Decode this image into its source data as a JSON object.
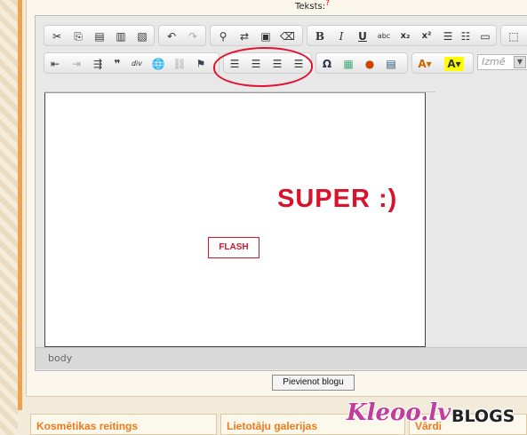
{
  "form": {
    "field_label": "Teksts:",
    "required_mark": "?",
    "submit_label": "Pievienot blogu"
  },
  "toolbar": {
    "row1": [
      {
        "name": "cut-icon",
        "glyph": "✂"
      },
      {
        "name": "copy-icon",
        "glyph": "⎘"
      },
      {
        "name": "paste-icon",
        "glyph": "📋"
      },
      {
        "name": "paste-text-icon",
        "glyph": "📄"
      },
      {
        "name": "paste-word-icon",
        "glyph": "W"
      },
      {
        "name": "undo-icon",
        "glyph": "↶"
      },
      {
        "name": "redo-icon",
        "glyph": "↷"
      },
      {
        "name": "find-icon",
        "glyph": "🔍"
      },
      {
        "name": "replace-icon",
        "glyph": "⇄"
      },
      {
        "name": "select-all-icon",
        "glyph": "▣"
      },
      {
        "name": "remove-format-icon",
        "glyph": "⌫"
      },
      {
        "name": "bold-button",
        "glyph": "B"
      },
      {
        "name": "italic-button",
        "glyph": "I"
      },
      {
        "name": "underline-button",
        "glyph": "U"
      },
      {
        "name": "strikethrough-button",
        "glyph": "abc"
      },
      {
        "name": "subscript-button",
        "glyph": "x₂"
      },
      {
        "name": "superscript-button",
        "glyph": "x²"
      },
      {
        "name": "numbered-list-icon",
        "glyph": "☰"
      },
      {
        "name": "bulleted-list-icon",
        "glyph": "☷"
      },
      {
        "name": "horizontal-rule-icon",
        "glyph": "▭"
      },
      {
        "name": "maximize-icon",
        "glyph": "⬚"
      }
    ],
    "row2": [
      {
        "name": "outdent-icon",
        "glyph": "⇤"
      },
      {
        "name": "indent-icon",
        "glyph": "⇥"
      },
      {
        "name": "indent-more-icon",
        "glyph": "⇶"
      },
      {
        "name": "blockquote-icon",
        "glyph": "❞"
      },
      {
        "name": "div-container-icon",
        "glyph": "div"
      },
      {
        "name": "link-icon",
        "glyph": "🔗"
      },
      {
        "name": "unlink-icon",
        "glyph": "⛓"
      },
      {
        "name": "anchor-flag-icon",
        "glyph": "⚑"
      },
      {
        "name": "align-left-icon",
        "glyph": "≡"
      },
      {
        "name": "align-center-icon",
        "glyph": "≡"
      },
      {
        "name": "align-right-icon",
        "glyph": "≡"
      },
      {
        "name": "align-justify-icon",
        "glyph": "≡"
      },
      {
        "name": "special-char-icon",
        "glyph": "Ω"
      },
      {
        "name": "image-icon",
        "glyph": "▦"
      },
      {
        "name": "flash-icon",
        "glyph": "✎"
      },
      {
        "name": "table-icon",
        "glyph": "▤"
      },
      {
        "name": "text-color-icon",
        "glyph": "A"
      },
      {
        "name": "bg-color-icon",
        "glyph": "A"
      }
    ],
    "size_placeholder": "Izmē"
  },
  "content": {
    "headline": "SUPER :)",
    "flash_label": "FLASH"
  },
  "statusbar": {
    "path": "body"
  },
  "footer": {
    "box1": "Kosmētikas reitings",
    "box2": "Lietotāju galerijas",
    "box3": "Vārdi"
  },
  "brand": {
    "logo": "Kleoo.lv",
    "suffix": "BLOGS"
  },
  "colors": {
    "accent_orange": "#f07a1a",
    "headline_red": "#d8142c",
    "annotation_red": "#e3102e",
    "brand_pink": "#c33d9a"
  }
}
